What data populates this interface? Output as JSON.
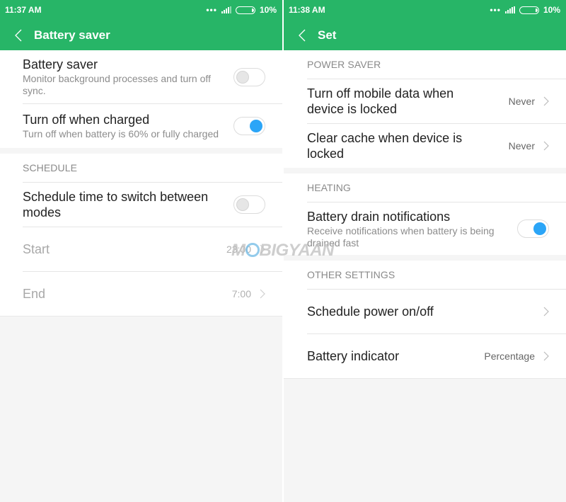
{
  "left": {
    "status": {
      "time": "11:37 AM",
      "dots_icon": "more-dots-icon",
      "signal_icon": "signal-icon",
      "battery_icon": "battery-icon",
      "battery": "10%"
    },
    "appbar": {
      "back_icon": "back-chevron-icon",
      "title": "Battery saver"
    },
    "sections": [
      {
        "header": "",
        "rows": [
          {
            "title": "Battery saver",
            "subtitle": "Monitor background processes and turn off sync.",
            "toggle": "off"
          },
          {
            "title": "Turn off when charged",
            "subtitle": "Turn off when battery is 60% or fully charged",
            "toggle": "on"
          }
        ]
      },
      {
        "header": "SCHEDULE",
        "rows": [
          {
            "title": "Schedule time to switch between modes",
            "toggle": "off"
          },
          {
            "title": "Start",
            "value": "23:00",
            "disabled": true
          },
          {
            "title": "End",
            "value": "7:00",
            "disabled": true
          }
        ]
      }
    ]
  },
  "right": {
    "status": {
      "time": "11:38 AM",
      "dots_icon": "more-dots-icon",
      "signal_icon": "signal-icon",
      "battery_icon": "battery-icon",
      "battery": "10%"
    },
    "appbar": {
      "back_icon": "back-chevron-icon",
      "title": "Set"
    },
    "sections": [
      {
        "header": "POWER SAVER",
        "rows": [
          {
            "title": "Turn off mobile data when device is locked",
            "value": "Never"
          },
          {
            "title": "Clear cache when device is locked",
            "value": "Never"
          }
        ]
      },
      {
        "header": "HEATING",
        "rows": [
          {
            "title": "Battery drain notifications",
            "subtitle": "Receive notifications when battery is being drained fast",
            "toggle": "on"
          }
        ]
      },
      {
        "header": "OTHER SETTINGS",
        "rows": [
          {
            "title": "Schedule power on/off",
            "value": ""
          },
          {
            "title": "Battery indicator",
            "value": "Percentage"
          }
        ]
      }
    ]
  },
  "watermark": {
    "text_pre": "M",
    "text_post": "BIGYAAN"
  },
  "colors": {
    "accent": "#27b567",
    "toggle_on": "#2ba5f7",
    "background": "#f5f5f5"
  }
}
